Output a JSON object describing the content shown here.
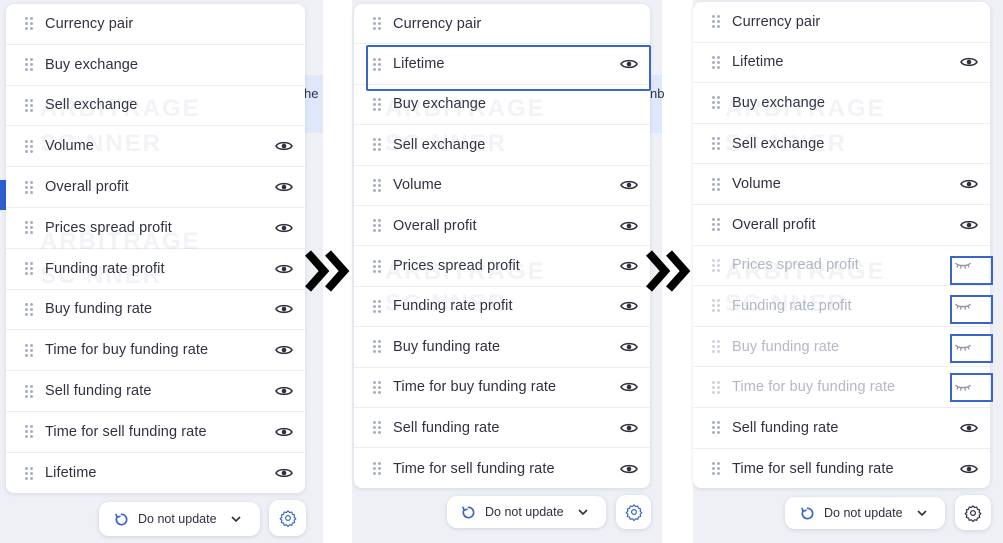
{
  "panel1": {
    "rows": [
      {
        "label": "Currency pair",
        "eye": "none"
      },
      {
        "label": "Buy exchange",
        "eye": "none"
      },
      {
        "label": "Sell exchange",
        "eye": "none"
      },
      {
        "label": "Volume",
        "eye": "open"
      },
      {
        "label": "Overall profit",
        "eye": "open"
      },
      {
        "label": "Prices spread profit",
        "eye": "open"
      },
      {
        "label": "Funding rate profit",
        "eye": "open"
      },
      {
        "label": "Buy funding rate",
        "eye": "open"
      },
      {
        "label": "Time for buy funding rate",
        "eye": "open"
      },
      {
        "label": "Sell funding rate",
        "eye": "open"
      },
      {
        "label": "Time for sell funding rate",
        "eye": "open"
      },
      {
        "label": "Lifetime",
        "eye": "open"
      }
    ],
    "update_label": "Do not update"
  },
  "panel2": {
    "rows": [
      {
        "label": "Currency pair",
        "eye": "none"
      },
      {
        "label": "Lifetime",
        "eye": "open"
      },
      {
        "label": "Buy exchange",
        "eye": "none"
      },
      {
        "label": "Sell exchange",
        "eye": "none"
      },
      {
        "label": "Volume",
        "eye": "open"
      },
      {
        "label": "Overall profit",
        "eye": "open"
      },
      {
        "label": "Prices spread profit",
        "eye": "open"
      },
      {
        "label": "Funding rate profit",
        "eye": "open"
      },
      {
        "label": "Buy funding rate",
        "eye": "open"
      },
      {
        "label": "Time for buy funding rate",
        "eye": "open"
      },
      {
        "label": "Sell funding rate",
        "eye": "open"
      },
      {
        "label": "Time for sell funding rate",
        "eye": "open"
      }
    ],
    "update_label": "Do not update"
  },
  "panel3": {
    "rows": [
      {
        "label": "Currency pair",
        "eye": "none"
      },
      {
        "label": "Lifetime",
        "eye": "open"
      },
      {
        "label": "Buy exchange",
        "eye": "none"
      },
      {
        "label": "Sell exchange",
        "eye": "none"
      },
      {
        "label": "Volume",
        "eye": "open"
      },
      {
        "label": "Overall profit",
        "eye": "open"
      },
      {
        "label": "Prices spread profit",
        "eye": "closed"
      },
      {
        "label": "Funding rate profit",
        "eye": "closed"
      },
      {
        "label": "Buy funding rate",
        "eye": "closed"
      },
      {
        "label": "Time for buy funding rate",
        "eye": "closed"
      },
      {
        "label": "Sell funding rate",
        "eye": "open"
      },
      {
        "label": "Time for sell funding rate",
        "eye": "open"
      }
    ],
    "update_label": "Do not update"
  },
  "watermark": {
    "line1": "ARBITRAGE",
    "line2": "SC NNER"
  },
  "clipped_text": {
    "left_he": "he",
    "right_nb": "nb"
  },
  "colors": {
    "accent": "#3a66c9",
    "text": "#2f3140",
    "dim_text": "#b4b8c4",
    "icon": "#2f3140"
  }
}
